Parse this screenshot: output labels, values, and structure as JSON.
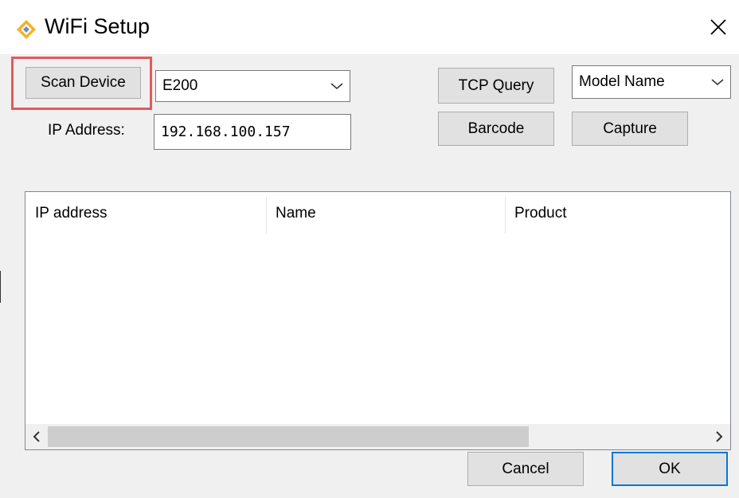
{
  "window": {
    "title": "WiFi Setup",
    "app_icon": "diamond-icon",
    "close_icon": "close-icon"
  },
  "toolbar": {
    "scan_device_label": "Scan Device",
    "device_combo_value": "E200",
    "ip_address_label": "IP Address:",
    "ip_address_value": "192.168.100.157",
    "tcp_query_label": "TCP Query",
    "barcode_label": "Barcode",
    "capture_label": "Capture",
    "model_combo_value": "Model Name"
  },
  "list": {
    "columns": [
      "IP address",
      "Name",
      "Product"
    ],
    "rows": []
  },
  "footer": {
    "cancel_label": "Cancel",
    "ok_label": "OK"
  },
  "colors": {
    "highlight": "#e35a5a",
    "default_button_border": "#0078d7",
    "icon_gold": "#f0b429"
  }
}
